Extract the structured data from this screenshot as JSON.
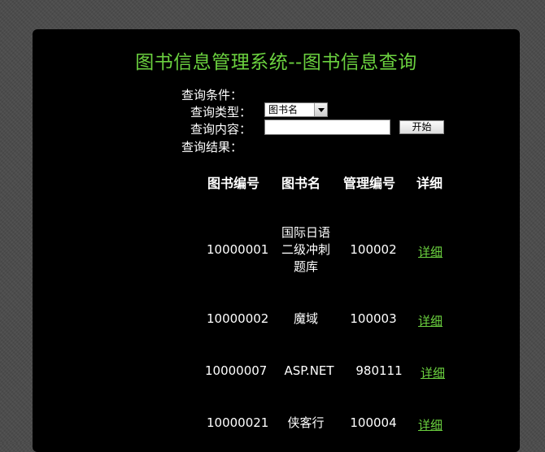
{
  "title": "图书信息管理系统--图书信息查询",
  "search": {
    "conditions_label": "查询条件：",
    "type_label": "查询类型：",
    "type_selected": "图书名",
    "content_label": "查询内容：",
    "content_value": "",
    "start_button": "开始",
    "results_label": "查询结果："
  },
  "table": {
    "headers": [
      "图书编号",
      "图书名",
      "管理编号",
      "详细"
    ],
    "rows": [
      {
        "id": "10000001",
        "name": "国际日语二级冲刺题库",
        "name_lines": [
          "国际日语",
          "二级冲刺",
          "题库"
        ],
        "admin": "100002",
        "detail": "详细"
      },
      {
        "id": "10000002",
        "name": "魔域",
        "admin": "100003",
        "detail": "详细"
      },
      {
        "id": "10000007",
        "name": "ASP.NET",
        "admin": "980111",
        "detail": "详细"
      },
      {
        "id": "10000021",
        "name": "侠客行",
        "admin": "100004",
        "detail": "详细"
      }
    ]
  },
  "colors": {
    "accent": "#6bd13f",
    "panel": "#000000",
    "background": "#4a4a4a"
  }
}
